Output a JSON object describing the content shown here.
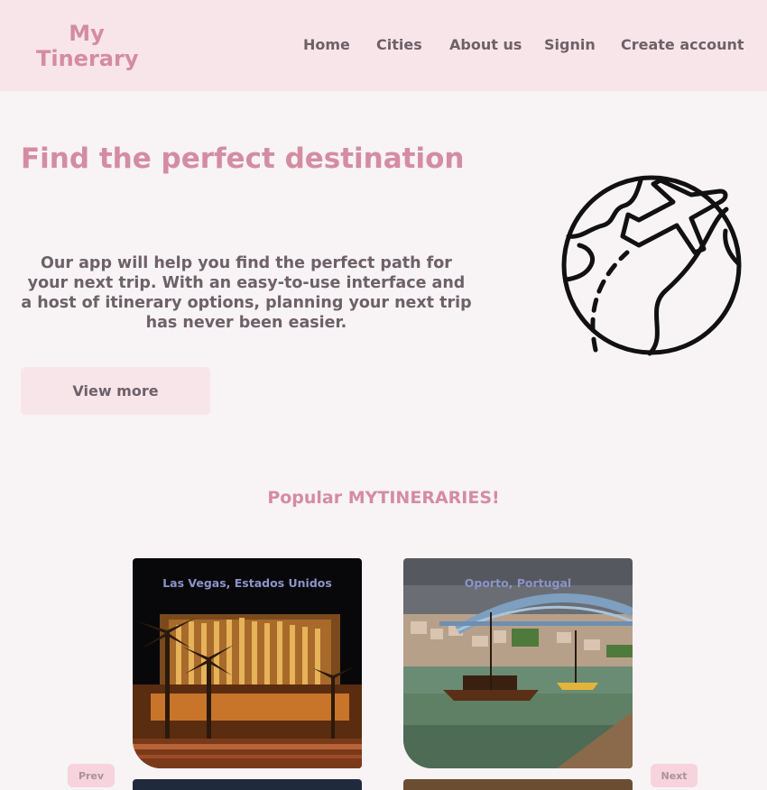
{
  "brand": {
    "line1": "My",
    "line2": "Tinerary"
  },
  "nav": {
    "home": "Home",
    "cities": "Cities",
    "about": "About us",
    "signin": "Signin",
    "create_account": "Create account"
  },
  "hero": {
    "title": "Find the perfect destination",
    "text": "Our app will help you find the perfect path for your next trip. With an easy-to-use interface and a host of itinerary options, planning your next trip has never been easier.",
    "button": "View more",
    "illustration": "globe-with-airplane-icon"
  },
  "popular": {
    "title": "Popular MYTINERARIES!",
    "cards": [
      {
        "title": "Las Vegas, Estados Unidos"
      },
      {
        "title": "Oporto, Portugal"
      }
    ],
    "prev": "Prev",
    "next": "Next"
  },
  "colors": {
    "accent": "#d48ca3",
    "header_bg": "#f8e5ea",
    "page_bg": "#f8f3f5",
    "text": "#6d6168"
  }
}
